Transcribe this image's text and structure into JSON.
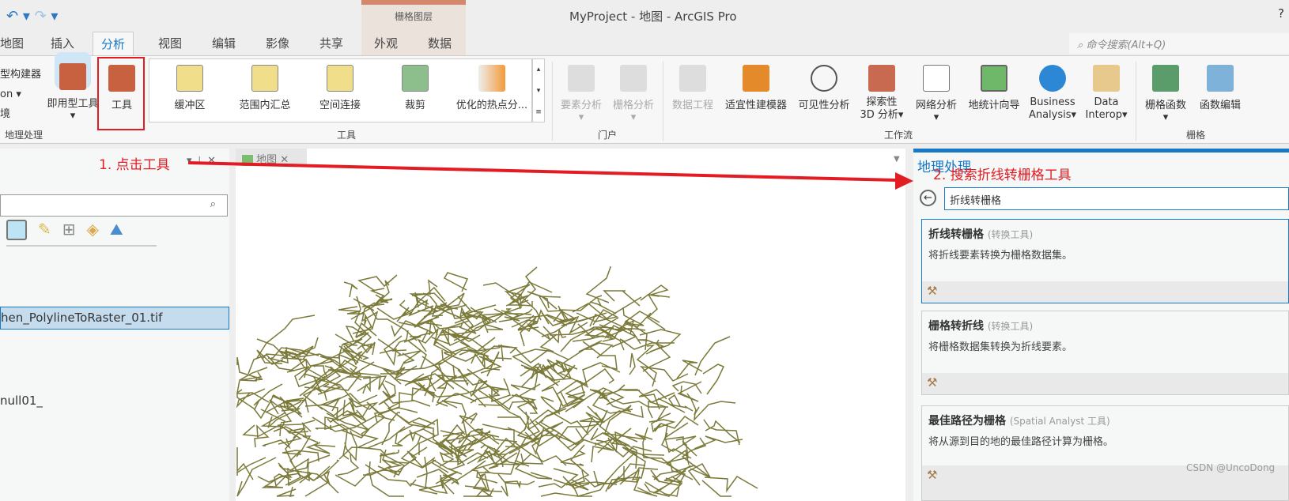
{
  "window": {
    "title": "MyProject - 地图 - ArcGIS Pro",
    "help": "?",
    "undo": "↶",
    "redo": "↷"
  },
  "context_tab_group": "栅格图层",
  "command_search": {
    "placeholder": "命令搜索(Alt+Q)"
  },
  "tabs": [
    {
      "label": "地图"
    },
    {
      "label": "插入"
    },
    {
      "label": "分析",
      "active": true
    },
    {
      "label": "视图"
    },
    {
      "label": "编辑"
    },
    {
      "label": "影像"
    },
    {
      "label": "共享"
    },
    {
      "label": "外观"
    },
    {
      "label": "数据"
    }
  ],
  "ribbon": {
    "geoprocessing": {
      "label": "地理处理",
      "items": [
        "型构建器",
        "on ▾",
        "境"
      ],
      "ready_tools": "即用型工具",
      "tools": "工具"
    },
    "tools_gallery": {
      "label": "工具",
      "items": [
        "缓冲区",
        "范围内汇总",
        "空间连接",
        "裁剪",
        "优化的热点分..."
      ]
    },
    "portal": {
      "label": "门户",
      "items": [
        "要素分析",
        "栅格分析"
      ]
    },
    "workflows": {
      "label": "工作流",
      "items": [
        "数据工程",
        "适宜性建模器",
        "可见性分析",
        "探索性\n3D 分析▾",
        "网络分析",
        "地统计向导",
        "Business\nAnalysis▾",
        "Data\nInterop▾"
      ]
    },
    "raster": {
      "label": "栅格",
      "items": [
        "栅格函数",
        "函数编辑"
      ]
    }
  },
  "annotations": {
    "step1": "1. 点击工具",
    "step2": "2. 搜索折线转栅格工具"
  },
  "left_pane": {
    "selected_item": "hen_PolylineToRaster_01.tif",
    "item2": "null01_"
  },
  "map_tab": {
    "label": "地图"
  },
  "map": {
    "line_color": "#7b7a3a"
  },
  "geoprocessing": {
    "title": "地理处理",
    "search_value": "折线转栅格",
    "results": [
      {
        "name": "折线转栅格",
        "category": "(转换工具)",
        "desc": "将折线要素转换为栅格数据集。"
      },
      {
        "name": "栅格转折线",
        "category": "(转换工具)",
        "desc": "将栅格数据集转换为折线要素。"
      },
      {
        "name": "最佳路径为栅格",
        "category": "(Spatial Analyst 工具)",
        "desc": "将从源到目的地的最佳路径计算为栅格。"
      }
    ]
  },
  "watermark": "CSDN @UncoDong"
}
